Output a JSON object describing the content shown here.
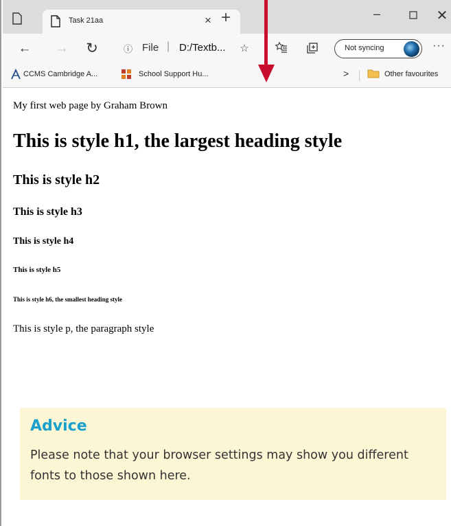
{
  "browser": {
    "tab": {
      "title": "Task 21aa",
      "close_glyph": "×"
    },
    "new_tab_glyph": "+",
    "window_controls": {
      "minimize": "–",
      "maximize": "☐",
      "close": "✕"
    },
    "address": {
      "info_glyph": "ⓘ",
      "scheme_label": "File",
      "separator": "|",
      "url": "D:/Textb..."
    },
    "toolbar_icons": [
      "favorite-star-icon",
      "favorites-list-icon",
      "collections-icon"
    ],
    "profile": {
      "label": "Not syncing"
    },
    "more_glyph": "···",
    "favorites_bar": {
      "items": [
        {
          "label": "CCMS Cambridge A...",
          "icon": "cambridge-logo-icon"
        },
        {
          "label": "School Support Hu...",
          "icon": "shield-crest-icon"
        }
      ],
      "overflow_glyph": ">",
      "other_label": "Other favourites"
    }
  },
  "page": {
    "intro": "My first web page by Graham Brown",
    "h1": "This is style h1, the largest heading style",
    "h2": "This is style h2",
    "h3": "This is style h3",
    "h4": "This is style h4",
    "h5": "This is style h5",
    "h6": "This is style h6, the smallest heading style",
    "p": "This is style p, the paragraph style"
  },
  "advice": {
    "title": "Advice",
    "text": "Please note that your browser settings may show you different fonts to those shown here."
  },
  "colors": {
    "arrow": "#c8102e",
    "advice_bg": "#fdf6d5",
    "advice_title": "#1aa0cc",
    "tabstrip": "#dcdcdc",
    "toolbar": "#f7f7f7"
  }
}
